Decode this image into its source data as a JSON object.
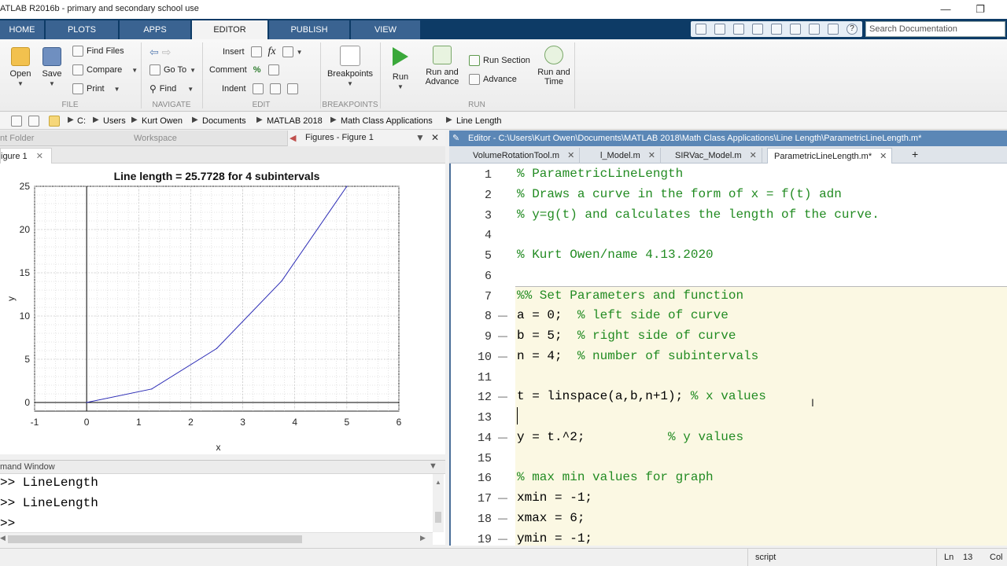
{
  "window": {
    "title": "ATLAB R2016b - primary and secondary school use"
  },
  "ribbon_tabs": [
    "HOME",
    "PLOTS",
    "APPS",
    "EDITOR",
    "PUBLISH",
    "VIEW"
  ],
  "search": {
    "placeholder": "Search Documentation"
  },
  "ribbon": {
    "file": {
      "open": "Open",
      "save": "Save",
      "find_files": "Find Files",
      "compare": "Compare",
      "print": "Print",
      "label": "FILE"
    },
    "navigate": {
      "go_to": "Go To",
      "find": "Find",
      "label": "NAVIGATE"
    },
    "edit": {
      "insert": "Insert",
      "comment": "Comment",
      "indent": "Indent",
      "fx": "fx",
      "label": "EDIT"
    },
    "breakpoints": {
      "breakpoints": "Breakpoints",
      "label": "BREAKPOINTS"
    },
    "run": {
      "run": "Run",
      "run_and_advance_1": "Run and",
      "run_and_advance_2": "Advance",
      "run_section": "Run Section",
      "advance": "Advance",
      "run_and_time_1": "Run and",
      "run_and_time_2": "Time",
      "label": "RUN"
    }
  },
  "breadcrumb": [
    "C:",
    "Users",
    "Kurt Owen",
    "Documents",
    "MATLAB 2018",
    "Math Class Applications",
    "Line Length"
  ],
  "left_panel": {
    "current_folder": "nt Folder",
    "workspace": "Workspace",
    "figures_title": "Figures - Figure 1",
    "figure_tab": "igure 1",
    "command_window": "mand Window",
    "command_lines": [
      ">> LineLength",
      ">> LineLength",
      ">>"
    ]
  },
  "chart_data": {
    "type": "line",
    "title": "Line length = 25.7728  for 4 subintervals",
    "xlabel": "x",
    "ylabel": "y",
    "xlim": [
      -1,
      6
    ],
    "ylim": [
      -1,
      25
    ],
    "xticks": [
      "-1",
      "0",
      "1",
      "2",
      "3",
      "4",
      "5",
      "6"
    ],
    "yticks": [
      "0",
      "5",
      "10",
      "15",
      "20",
      "25"
    ],
    "grid": "minor",
    "series": [
      {
        "x": [
          0,
          1.25,
          2.5,
          3.75,
          5
        ],
        "y": [
          0,
          1.5625,
          6.25,
          14.0625,
          25
        ]
      }
    ],
    "colors": {
      "line": "#2b2bb5",
      "grid": "#c8c8c8"
    }
  },
  "editor": {
    "path": "Editor - C:\\Users\\Kurt Owen\\Documents\\MATLAB 2018\\Math Class Applications\\Line Length\\ParametricLineLength.m*",
    "tabs": [
      "VolumeRotationTool.m",
      "l_Model.m",
      "SIRVac_Model.m",
      "ParametricLineLength.m*"
    ],
    "add_tab": "+",
    "lines": [
      {
        "n": "1",
        "code": "",
        "comment": "% ParametricLineLength"
      },
      {
        "n": "2",
        "code": "",
        "comment": "% Draws a curve in the form of x = f(t) adn"
      },
      {
        "n": "3",
        "code": "",
        "comment": "% y=g(t) and calculates the length of the curve."
      },
      {
        "n": "4",
        "code": "",
        "comment": ""
      },
      {
        "n": "5",
        "code": "",
        "comment": "% Kurt Owen/name 4.13.2020"
      },
      {
        "n": "6",
        "code": "",
        "comment": ""
      },
      {
        "n": "7",
        "code": "",
        "comment": "%% Set Parameters and function"
      },
      {
        "n": "8",
        "code": "a = 0;  ",
        "comment": "% left side of curve"
      },
      {
        "n": "9",
        "code": "b = 5;  ",
        "comment": "% right side of curve"
      },
      {
        "n": "10",
        "code": "n = 4;  ",
        "comment": "% number of subintervals"
      },
      {
        "n": "11",
        "code": "",
        "comment": ""
      },
      {
        "n": "12",
        "code": "t = linspace(a,b,n+1); ",
        "comment": "% x values"
      },
      {
        "n": "13",
        "code": "",
        "comment": ""
      },
      {
        "n": "14",
        "code": "y = t.^2;           ",
        "comment": "% y values"
      },
      {
        "n": "15",
        "code": "",
        "comment": ""
      },
      {
        "n": "16",
        "code": "",
        "comment": "% max min values for graph"
      },
      {
        "n": "17",
        "code": "xmin = -1;",
        "comment": ""
      },
      {
        "n": "18",
        "code": "xmax = 6;",
        "comment": ""
      },
      {
        "n": "19",
        "code": "ymin = -1;",
        "comment": ""
      }
    ],
    "dash_lines": [
      "8",
      "9",
      "10",
      "12",
      "14",
      "17",
      "18",
      "19"
    ]
  },
  "status": {
    "type": "script",
    "ln_label": "Ln",
    "ln_value": "13",
    "col_label": "Col"
  }
}
